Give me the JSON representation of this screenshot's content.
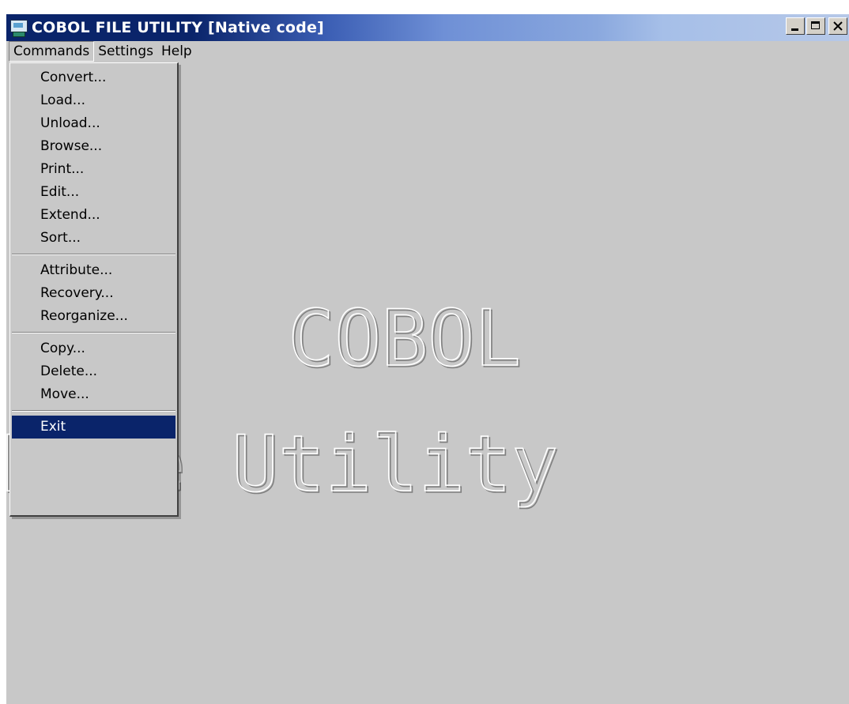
{
  "window": {
    "title": "COBOL FILE UTILITY [Native code]",
    "icon": "app-icon"
  },
  "menubar": {
    "items": [
      "Commands",
      "Settings",
      "Help"
    ]
  },
  "commands_menu": {
    "groups": [
      [
        "Convert...",
        "Load...",
        "Unload...",
        "Browse...",
        "Print...",
        "Edit...",
        "Extend...",
        "Sort..."
      ],
      [
        "Attribute...",
        "Recovery...",
        "Reorganize..."
      ],
      [
        "Copy...",
        "Delete...",
        "Move..."
      ],
      [
        "Exit"
      ]
    ],
    "selected": "Exit"
  },
  "background_art": {
    "line1": "COBOL",
    "line2": "File Utility"
  },
  "colors": {
    "face": "#c8c8c8",
    "highlight": "#0a246a",
    "title_start": "#0a246a"
  }
}
